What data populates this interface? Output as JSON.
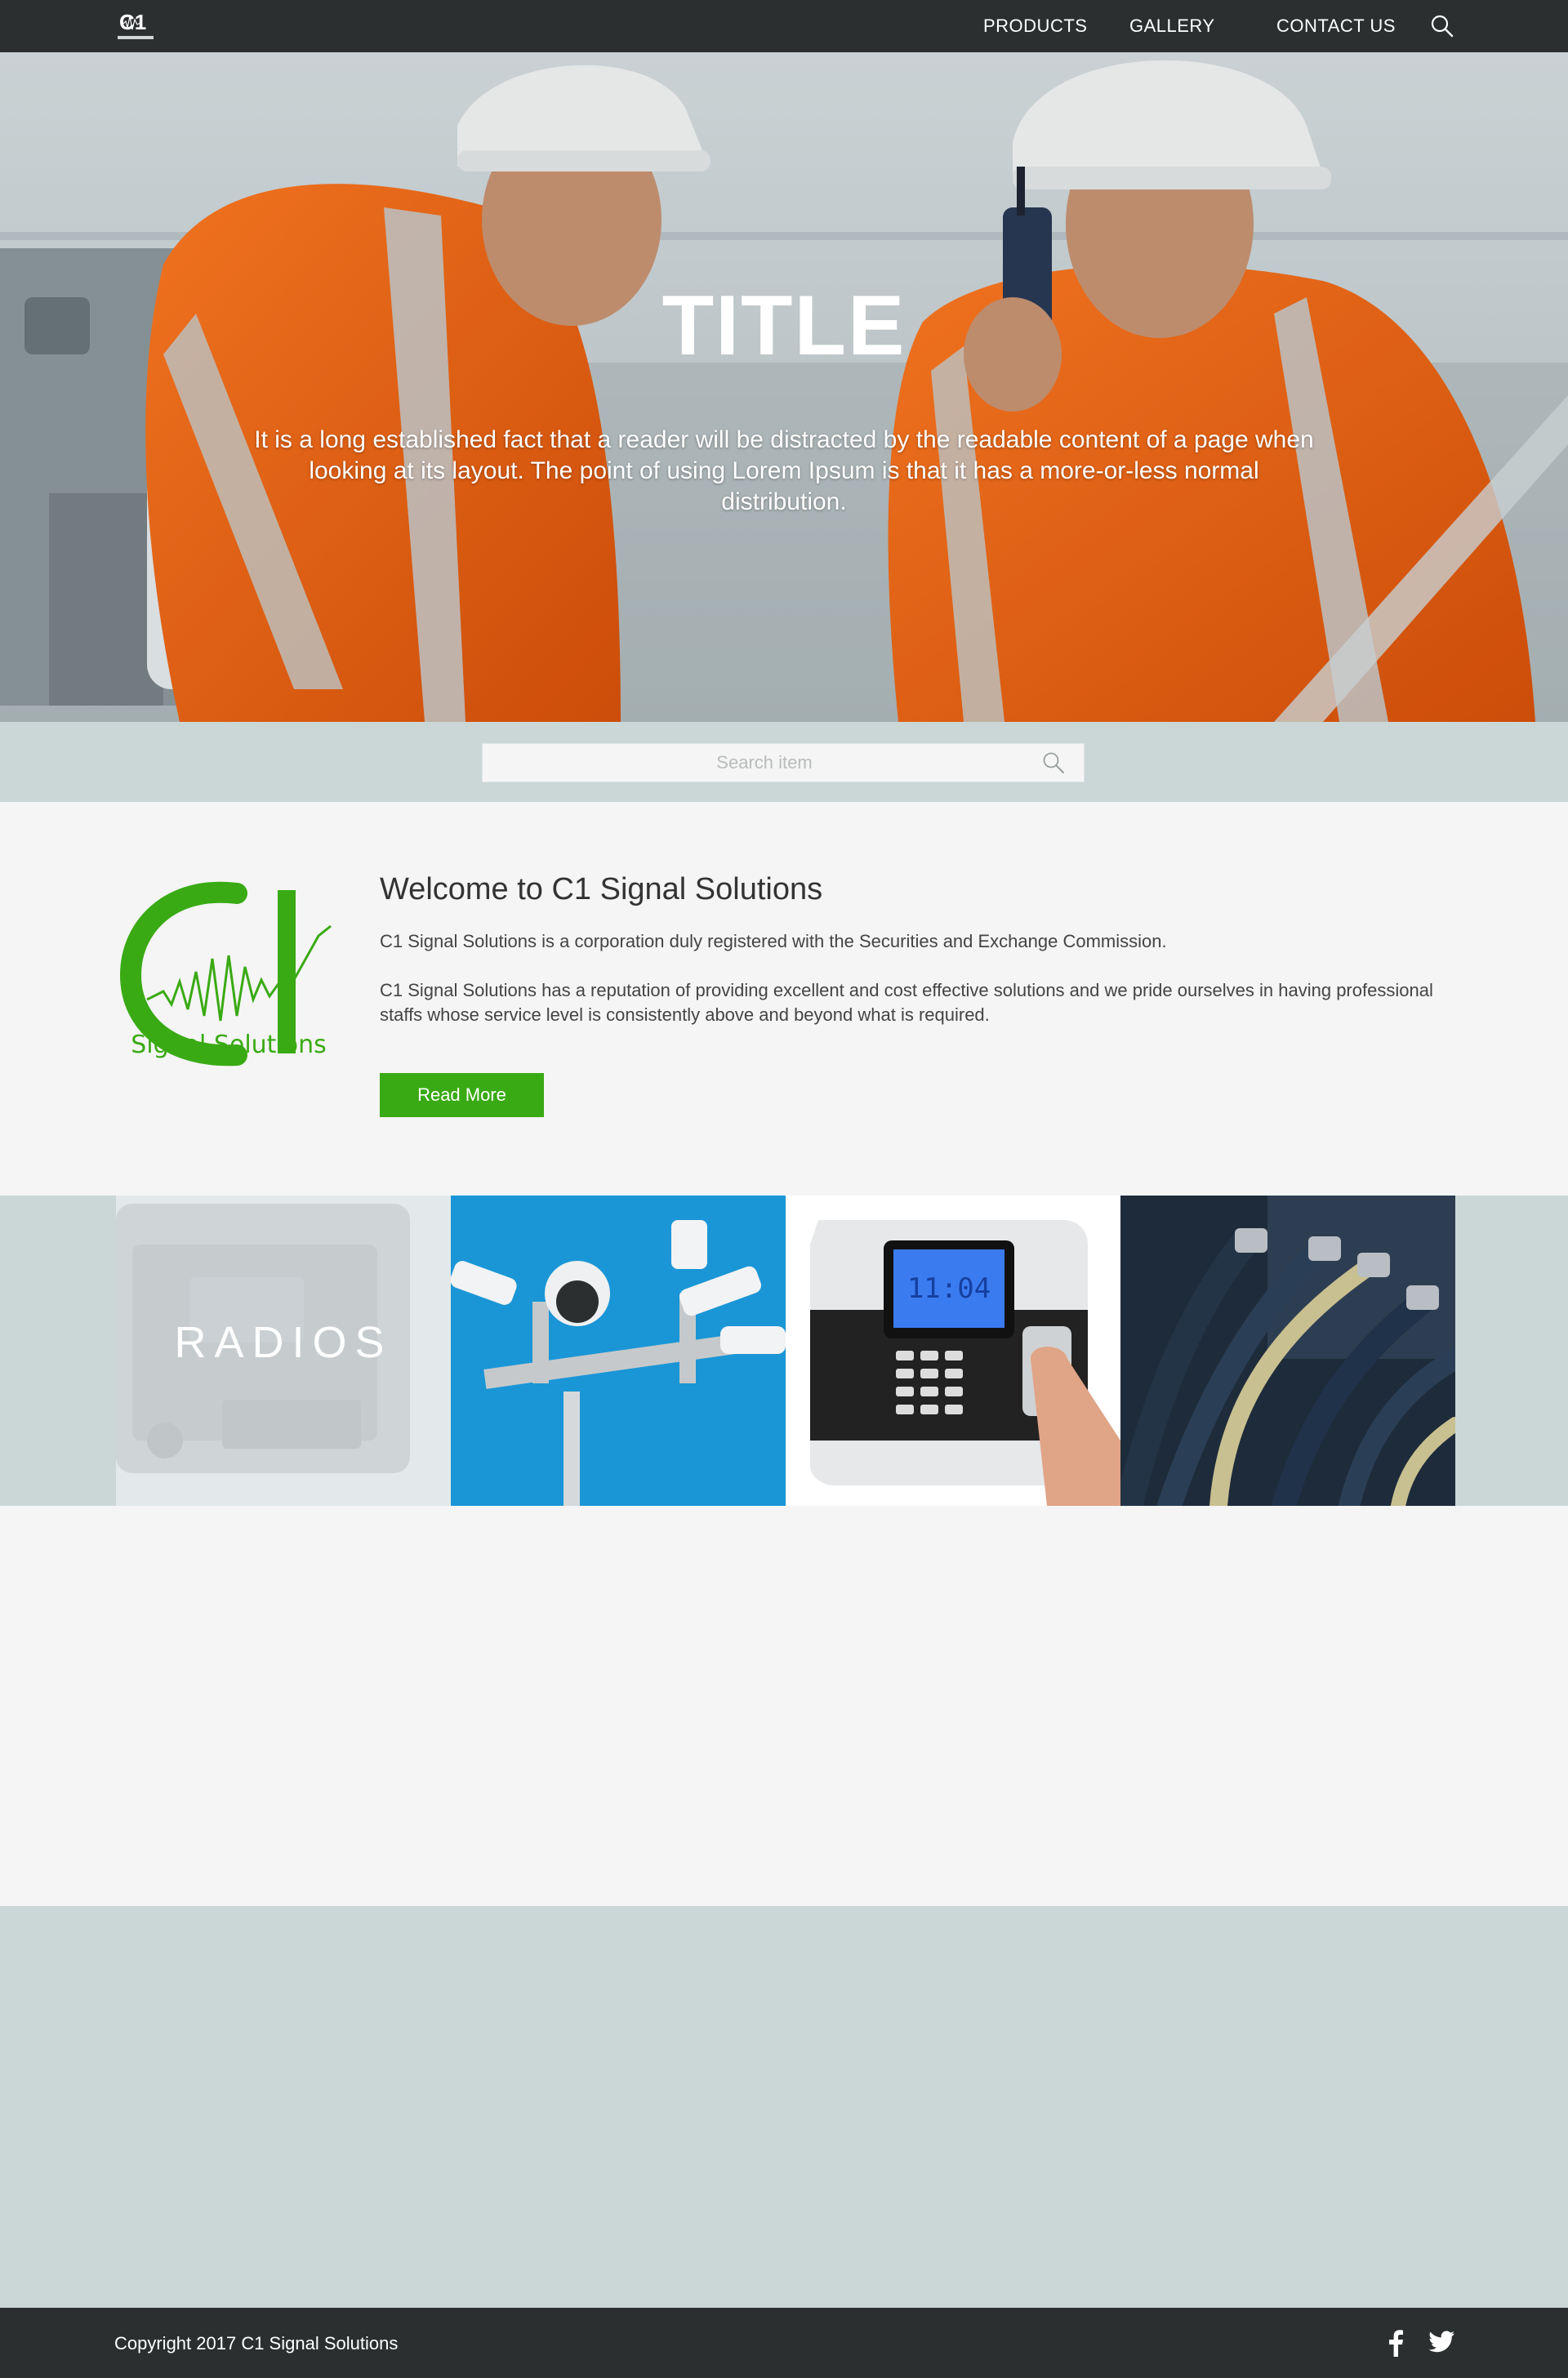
{
  "nav": {
    "logo_text": "C1",
    "items": [
      {
        "label": "PRODUCTS"
      },
      {
        "label": "GALLERY"
      },
      {
        "label": "CONTACT US"
      }
    ],
    "search_icon": "search-icon"
  },
  "hero": {
    "title": "TITLE",
    "subtitle": "It is a long established fact that a reader will be distracted by the readable content of a page when looking at its layout. The point of using Lorem Ipsum is that it has a more-or-less normal distribution."
  },
  "search": {
    "placeholder": "Search item",
    "value": ""
  },
  "welcome": {
    "logo_text": "C1",
    "logo_caption": "Signal Solutions",
    "title": "Welcome to C1 Signal Solutions",
    "paragraph1": "C1 Signal Solutions is a corporation duly registered with the Securities and Exchange Commission.",
    "paragraph2": "C1 Signal Solutions has a reputation of providing excellent and cost effective solutions and we pride ourselves in having professional staffs whose service level is consistently above and beyond what is required.",
    "button_label": "Read More"
  },
  "categories": [
    {
      "label": "RADIOS",
      "image": "radio-image"
    },
    {
      "label": "",
      "image": "cctv-image"
    },
    {
      "label": "",
      "image": "biometric-image"
    },
    {
      "label": "",
      "image": "cables-image"
    }
  ],
  "footer": {
    "copyright": "Copyright 2017 C1 Signal Solutions",
    "social": [
      "facebook-icon",
      "twitter-icon"
    ]
  },
  "colors": {
    "nav_bg": "#2b2f30",
    "accent_green": "#3aaa14",
    "band_gray": "#cbd7d7",
    "page_bg": "#f5f5f5"
  }
}
